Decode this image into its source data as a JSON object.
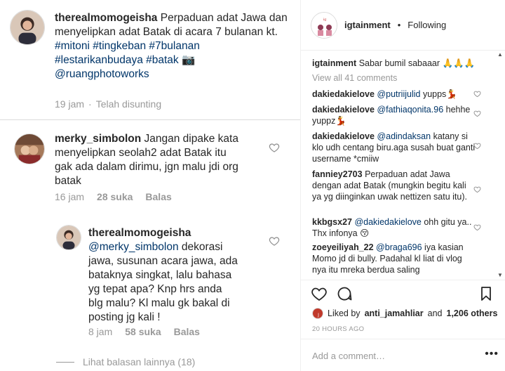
{
  "left": {
    "post": {
      "username": "therealmomogeisha",
      "caption": "Perpaduan adat Jawa dan menyelipkan adat Batak di acara 7 bulanan kt.",
      "hashtags_line1": "#mitoni #tingkeban #7bulanan",
      "hashtags_line2": "#lestarikanbudaya #batak",
      "camera_emoji": "📷",
      "mention": "@ruangphotoworks",
      "time": "19 jam",
      "dot": "·",
      "edited": "Telah disunting"
    },
    "comment": {
      "username": "merky_simbolon",
      "text_line1": "Jangan dipake kata",
      "text_line2": "menyelipkan seolah2 adat Batak itu",
      "text_line3": "gak ada dalam dirimu, jgn malu jdi org",
      "text_line4": "batak",
      "time": "16 jam",
      "likes": "28 suka",
      "reply": "Balas"
    },
    "reply": {
      "username": "therealmomogeisha",
      "mention": "@merky_simbolon",
      "text_line1": "dekorasi",
      "text_line2": "jawa, susunan acara jawa, ada",
      "text_line3": "bataknya singkat, lalu bahasa",
      "text_line4": "yg tepat apa? Knp hrs anda",
      "text_line5": "blg malu? Kl malu gk bakal di",
      "text_line6": "posting jg kali !",
      "time": "8 jam",
      "likes": "58 suka",
      "reply": "Balas"
    },
    "more_replies": "Lihat balasan lainnya (18)"
  },
  "right": {
    "header": {
      "username": "igtainment",
      "separator": "•",
      "follow": "Following"
    },
    "comments": [
      {
        "user": "igtainment",
        "mention": "",
        "text": "Sabar bumil sabaaar 🙏🙏🙏"
      },
      {
        "user": "dakiedakielove",
        "mention": "@putriijulid",
        "text": "yupps💃"
      },
      {
        "user": "dakiedakielove",
        "mention": "@fathiaqonita.96",
        "text": "hehhe yuppz💃"
      },
      {
        "user": "dakiedakielove",
        "mention": "@adindaksan",
        "text": "katany si klo udh centang biru.aga susah buat ganti username *cmiiw"
      },
      {
        "user": "fanniey2703",
        "mention": "",
        "text": "Perpaduan adat Jawa dengan adat Batak (mungkin begitu kali ya yg diinginkan uwak nettizen satu itu)."
      },
      {
        "user": "kkbgsx27",
        "mention": "@dakiedakielove",
        "text": "ohh gitu ya.. Thx infonya 😚"
      },
      {
        "user": "zoeyeiliyah_22",
        "mention": "@braga696",
        "text": "iya kasian Momo jd di bully. Padahal kl liat di vlog nya itu mreka berdua saling"
      }
    ],
    "view_all": "View all 41 comments",
    "likes_text_pre": "Liked by",
    "likes_user": "anti_jamahliar",
    "likes_and": "and",
    "likes_count": "1,206 others",
    "time_ago": "20 HOURS AGO",
    "add_comment_placeholder": "Add a comment…",
    "more_dots": "•••"
  },
  "icons": {
    "like": "heart-icon",
    "comment": "comment-icon",
    "share": "share-icon",
    "save": "bookmark-icon"
  }
}
